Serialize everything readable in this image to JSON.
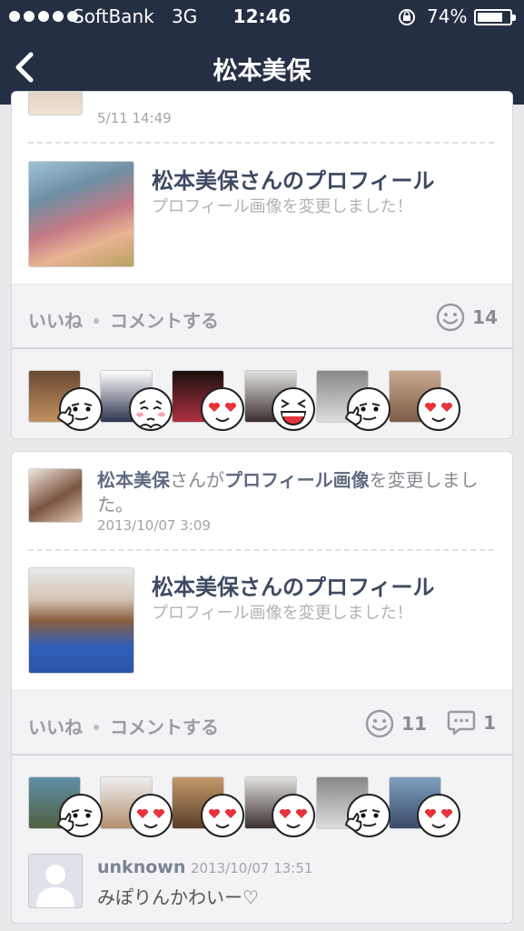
{
  "status_bar": {
    "carrier": "SoftBank",
    "network": "3G",
    "time": "12:46",
    "battery": "74%",
    "battery_level": 0.74,
    "signal_dots": 5
  },
  "nav": {
    "title": "松本美保",
    "back_icon": "chevron-left-icon"
  },
  "post1": {
    "timestamp": "5/11 14:49",
    "link_title": "松本美保さんのプロフィール",
    "link_subtitle": "プロフィール画像を変更しました！",
    "like_label": "いいね",
    "comment_label": "コメントする",
    "like_count": "14",
    "reactions": [
      "thumbs-up-smirk",
      "blushing",
      "heart-eyes",
      "grinning-laugh",
      "thumbs-up-smirk",
      "heart-eyes"
    ]
  },
  "post2": {
    "author": "松本美保",
    "message_mid": "さんが",
    "message_bold": "プロフィール画像",
    "message_end": "を変更しました。",
    "timestamp": "2013/10/07 3:09",
    "link_title": "松本美保さんのプロフィール",
    "link_subtitle": "プロフィール画像を変更しました！",
    "like_label": "いいね",
    "comment_label": "コメントする",
    "like_count": "11",
    "comment_count": "1",
    "reactions": [
      "thumbs-up-smirk",
      "heart-eyes",
      "heart-eyes",
      "heart-eyes",
      "thumbs-up-smirk",
      "heart-eyes"
    ],
    "comment": {
      "author": "unknown",
      "time": "2013/10/07 13:51",
      "text": "みぽりんかわいー♡"
    }
  },
  "colors": {
    "nav_bg": "#252f44",
    "page_bg": "#e9e9ec",
    "link_title": "#3d4a62"
  }
}
